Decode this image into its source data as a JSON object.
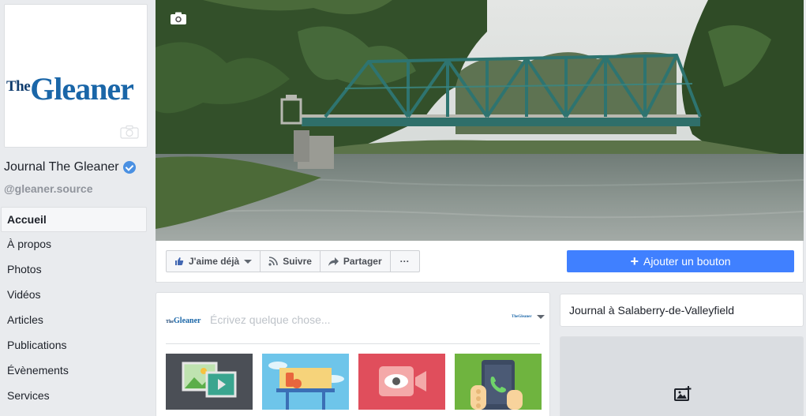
{
  "page": {
    "logo_the": "The",
    "logo_gleaner": "Gleaner",
    "name": "Journal The Gleaner",
    "handle": "@gleaner.source"
  },
  "nav": {
    "items": [
      {
        "label": "Accueil",
        "active": true
      },
      {
        "label": "À propos"
      },
      {
        "label": "Photos"
      },
      {
        "label": "Vidéos"
      },
      {
        "label": "Articles"
      },
      {
        "label": "Publications"
      },
      {
        "label": "Évènements"
      },
      {
        "label": "Services"
      }
    ]
  },
  "actions": {
    "like": "J'aime déjà",
    "follow": "Suivre",
    "share": "Partager",
    "more": "···",
    "add_button": "Ajouter un bouton"
  },
  "composer": {
    "placeholder": "Écrivez quelque chose...",
    "mini_logo_the": "The",
    "mini_logo_gleaner": "Gleaner",
    "tiles": [
      "photo-video-tile",
      "offer-tile",
      "live-video-tile",
      "contact-tile"
    ]
  },
  "sidebar_right": {
    "location": "Journal à Salaberry-de-Valleyfield"
  },
  "colors": {
    "brand_blue": "#4080ff",
    "verified": "#4a90e2",
    "logo_blue": "#1a66a8"
  }
}
